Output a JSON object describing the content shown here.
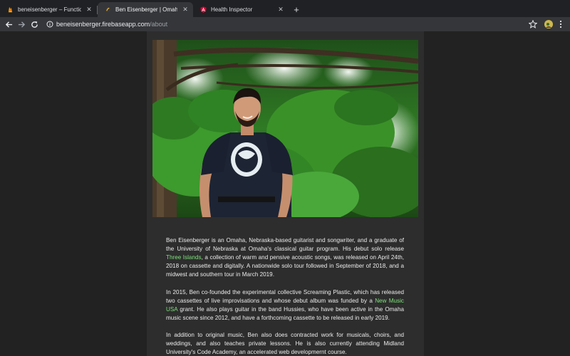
{
  "browser": {
    "tabs": [
      {
        "title": "beneisenberger – Functions – F",
        "favicon": "firebase-icon",
        "active": false
      },
      {
        "title": "Ben Eisenberger | Omaha-Base",
        "favicon": "site-icon",
        "active": true
      },
      {
        "title": "Health Inspector",
        "favicon": "angular-icon",
        "active": false
      }
    ],
    "new_tab": "+",
    "close_glyph": "✕",
    "url": {
      "host": "beneisenberger.firebaseapp.com",
      "path": "/about"
    }
  },
  "page": {
    "photo": {
      "subject": "man in a dark graphic t-shirt in front of pine trees",
      "icon": "photo-image"
    },
    "bio": [
      [
        {
          "text": "Ben Eisenberger is an Omaha, Nebraska-based guitarist and songwriter, and a graduate of the University of Nebraska at Omaha's classical guitar program. His debut solo release "
        },
        {
          "text": "Three Islands",
          "link": true
        },
        {
          "text": ", a collection of warm and pensive acoustic songs, was released on April 24th, 2018 on cassette and digitally. A nationwide solo tour followed in September of 2018, and a midwest and southern tour in March 2019."
        }
      ],
      [
        {
          "text": "In 2015, Ben co-founded the experimental collective Screaming Plastic, which has released two cassettes of live improvisations and whose debut album was funded by a "
        },
        {
          "text": "New Music USA",
          "link": true
        },
        {
          "text": " grant. He also plays guitar in the band Hussies, who have been active in the Omaha music scene since 2012, and have a forthcoming cassette to be released in early 2019."
        }
      ],
      [
        {
          "text": "In addition to original music, Ben also does contracted work for musicals, choirs, and weddings, and also teaches private lessons. He is also currently attending Midland University's Code Academy, an accelerated web developmernt course."
        }
      ]
    ]
  },
  "colors": {
    "link": "#7ee37a",
    "content_bg": "#2d2d2d",
    "page_bg": "#222222",
    "text": "#ececec"
  }
}
